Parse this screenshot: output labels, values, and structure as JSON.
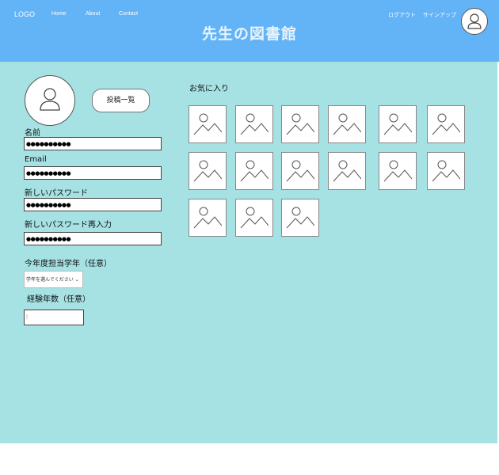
{
  "header": {
    "logo": "LOGO",
    "nav": [
      "Home",
      "About",
      "Contact"
    ],
    "title": "先生の図書館",
    "logout": "ログアウト",
    "signup": "サインアップ",
    "avatar_icon": "user-icon"
  },
  "profile": {
    "avatar_icon": "user-icon",
    "post_list_button": "投稿一覧",
    "name_label": "名前",
    "name_value": "●●●●●●●●●●",
    "email_label": "Email",
    "email_value": "●●●●●●●●●●",
    "new_password_label": "新しいパスワード",
    "new_password_value": "●●●●●●●●●●",
    "confirm_password_label": "新しいパスワード再入力",
    "confirm_password_value": "●●●●●●●●●●",
    "grade_label": "今年度担当学年（任意）",
    "grade_select_value": "学年を選んでください",
    "grade_select_arrow": "⌄",
    "years_label": "経験年数（任意）",
    "years_value": "|"
  },
  "favorites": {
    "title": "お気に入り",
    "thumbnail_icon": "image-placeholder-icon",
    "count": 15
  },
  "colors": {
    "header_bg": "#63b3f7",
    "main_bg": "#a6e1e3"
  }
}
